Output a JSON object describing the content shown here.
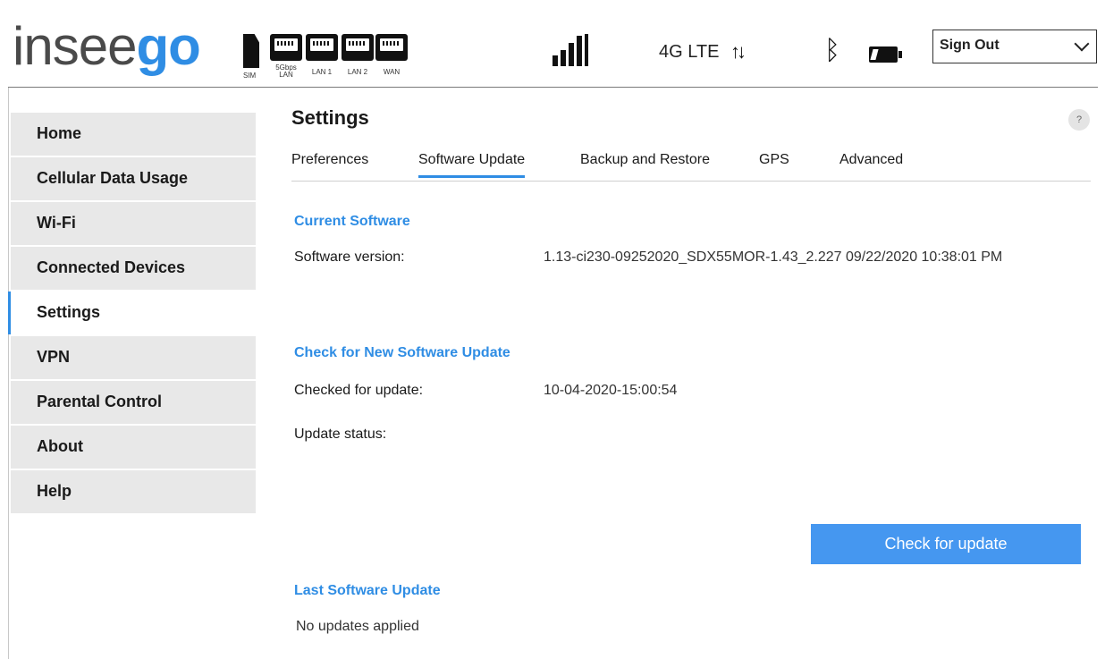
{
  "header": {
    "logo": {
      "light": "insee",
      "bold": "go"
    },
    "ports": [
      {
        "icon": "sim-icon",
        "label": "SIM"
      },
      {
        "icon": "ethernet-port-icon",
        "label": "5Gbps LAN"
      },
      {
        "icon": "ethernet-port-icon",
        "label": "LAN 1"
      },
      {
        "icon": "ethernet-port-icon",
        "label": "LAN 2"
      },
      {
        "icon": "ethernet-port-icon",
        "label": "WAN"
      }
    ],
    "network": "4G LTE",
    "signout": "Sign Out"
  },
  "sidebar": {
    "items": [
      {
        "label": "Home"
      },
      {
        "label": "Cellular Data Usage"
      },
      {
        "label": "Wi-Fi"
      },
      {
        "label": "Connected Devices"
      },
      {
        "label": "Settings",
        "active": true
      },
      {
        "label": "VPN"
      },
      {
        "label": "Parental Control"
      },
      {
        "label": "About"
      },
      {
        "label": "Help"
      }
    ]
  },
  "main": {
    "title": "Settings",
    "help": "?",
    "tabs": [
      {
        "label": "Preferences"
      },
      {
        "label": "Software Update",
        "active": true
      },
      {
        "label": "Backup and Restore"
      },
      {
        "label": "GPS"
      },
      {
        "label": "Advanced"
      }
    ],
    "current": {
      "title": "Current Software",
      "version_label": "Software version:",
      "version_value": "1.13-ci230-09252020_SDX55MOR-1.43_2.227 09/22/2020 10:38:01 PM"
    },
    "check": {
      "title": "Check for New Software Update",
      "checked_label": "Checked for update:",
      "checked_value": "10-04-2020-15:00:54",
      "status_label": "Update status:",
      "button": "Check for update"
    },
    "last": {
      "title": "Last Software Update",
      "value": "No updates applied"
    }
  },
  "colors": {
    "accent": "#2f8de4",
    "button": "#4597f0",
    "nav_bg": "#e8e8e8"
  }
}
